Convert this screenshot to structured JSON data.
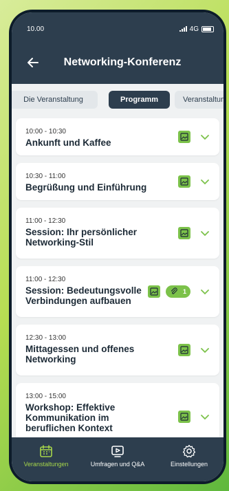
{
  "status": {
    "time": "10.00",
    "network": "4G"
  },
  "header": {
    "title": "Networking-Konferenz",
    "back_icon": "arrow-left-icon"
  },
  "tabs": [
    {
      "label": "Die Veranstaltung",
      "active": false
    },
    {
      "label": "Programm",
      "active": true
    },
    {
      "label": "Veranstaltungs",
      "active": false
    }
  ],
  "sessions": [
    {
      "time": "10:00 - 10:30",
      "title": "Ankunft und Kaffee"
    },
    {
      "time": "10:30 - 11:00",
      "title": "Begrüßung und Einführung"
    },
    {
      "time": "11:00 - 12:30",
      "title": "Session: Ihr persönlicher Networking-Stil"
    },
    {
      "time": "11:00 - 12:30",
      "title": "Session: Bedeutungsvolle Verbindungen aufbauen",
      "attachments": "1"
    },
    {
      "time": "12:30 - 13:00",
      "title": "Mittagessen und offenes Networking"
    },
    {
      "time": "13:00 - 15:00",
      "title": "Workshop: Effektive Kommunikation im beruflichen Kontext"
    }
  ],
  "bottom_nav": [
    {
      "label": "Veranstaltungen",
      "icon": "calendar-icon",
      "active": true
    },
    {
      "label": "Umfragen und Q&A",
      "icon": "play-screen-icon",
      "active": false
    },
    {
      "label": "Einstellungen",
      "icon": "gear-icon",
      "active": false
    }
  ],
  "colors": {
    "header": "#2d3e4e",
    "accent": "#7cc24a",
    "active_nav": "#a6d64a",
    "background": "#f0f2f3"
  }
}
